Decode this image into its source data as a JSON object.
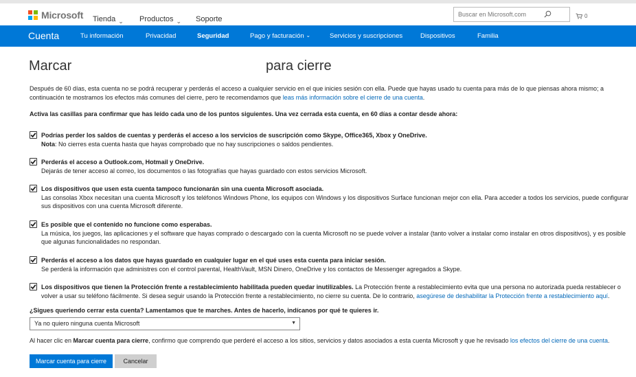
{
  "brand": {
    "name": "Microsoft",
    "logo_colors": [
      "#f25022",
      "#7fba00",
      "#00a4ef",
      "#ffb900"
    ]
  },
  "topnav": {
    "tienda": "Tienda",
    "productos": "Productos",
    "soporte": "Soporte",
    "search_placeholder": "Buscar en Microsoft.com",
    "cart_count": "0"
  },
  "bluenav": {
    "brand": "Cuenta",
    "items": [
      "Tu información",
      "Privacidad",
      "Seguridad",
      "Pago y facturación",
      "Servicios y suscripciones",
      "Dispositivos",
      "Familia"
    ],
    "active": "Seguridad",
    "color": "#0078d7"
  },
  "page": {
    "title_left": "Marcar",
    "title_right": "para cierre",
    "intro_1": "Después de 60 días, esta cuenta no se podrá recuperar y perderás el acceso a cualquier servicio en el que inicies sesión con ella. Puede que hayas usado tu cuenta para más de lo que piensas ahora mismo; a continuación te mostramos los efectos más comunes del cierre, pero te recomendamos que ",
    "intro_link": "leas más información sobre el cierre de una cuenta",
    "intro_2": ".",
    "instruction": "Activa las casillas para confirmar que has leído cada uno de los puntos siguientes. Una vez cerrada esta cuenta, en 60 días a contar desde ahora:",
    "items": [
      {
        "heading": "Podrías perder los saldos de cuentas y perderás el acceso a los servicios de suscripción como Skype, Office365, Xbox y OneDrive.",
        "note_label": "Nota",
        "detail": ": No cierres esta cuenta hasta que hayas comprobado que no hay suscripciones o saldos pendientes."
      },
      {
        "heading": "Perderás el acceso a Outlook.com, Hotmail y OneDrive.",
        "detail": "Dejarás de tener acceso al correo, los documentos o las fotografías que hayas guardado con estos servicios Microsoft."
      },
      {
        "heading": "Los dispositivos que usen esta cuenta tampoco funcionarán sin una cuenta Microsoft asociada.",
        "detail": "Las consolas Xbox necesitan una cuenta Microsoft y los teléfonos Windows Phone, los equipos con Windows y los dispositivos Surface funcionan mejor con ella. Para acceder a todos los servicios, puede configurar sus dispositivos con una cuenta Microsoft diferente."
      },
      {
        "heading": "Es posible que el contenido no funcione como esperabas.",
        "detail": "La música, los juegos, las aplicaciones y el software que hayas comprado o descargado con la cuenta Microsoft no se puede volver a instalar (tanto volver a instalar como instalar en otros dispositivos), y es posible que algunas funcionalidades no respondan."
      },
      {
        "heading": "Perderás el acceso a los datos que hayas guardado en cualquier lugar en el qué uses esta cuenta para iniciar sesión.",
        "detail": "Se perderá la información que administres con el control parental, HealthVault, MSN Dinero, OneDrive y los contactos de Messenger agregados a Skype."
      },
      {
        "heading": "Los dispositivos que tienen la Protección frente a restablecimiento habilitada pueden quedar inutilizables.",
        "detail": " La Protección frente a restablecimiento evita que una persona no autorizada pueda restablecer o volver a usar su teléfono fácilmente. Si desea seguir usando la Protección frente a restablecimiento, no cierre su cuenta. De lo contrario, ",
        "link": "asegúrese de deshabilitar la Protección frente a restablecimiento aquí",
        "after_link": "."
      }
    ],
    "reason_question": "¿Sigues queriendo cerrar esta cuenta? Lamentamos que te marches. Antes de hacerlo, indícanos por qué te quieres ir.",
    "reason_selected": "Ya no quiero ninguna cuenta Microsoft",
    "confirm_1": "Al hacer clic en ",
    "confirm_bold": "Marcar cuenta para cierre",
    "confirm_2": ", confirmo que comprendo que perderé el acceso a los sitios, servicios y datos asociados a esta cuenta Microsoft y que he revisado ",
    "confirm_link": "los efectos del cierre de una cuenta",
    "confirm_3": ".",
    "primary_button": "Marcar cuenta para cierre",
    "cancel_button": "Cancelar"
  }
}
